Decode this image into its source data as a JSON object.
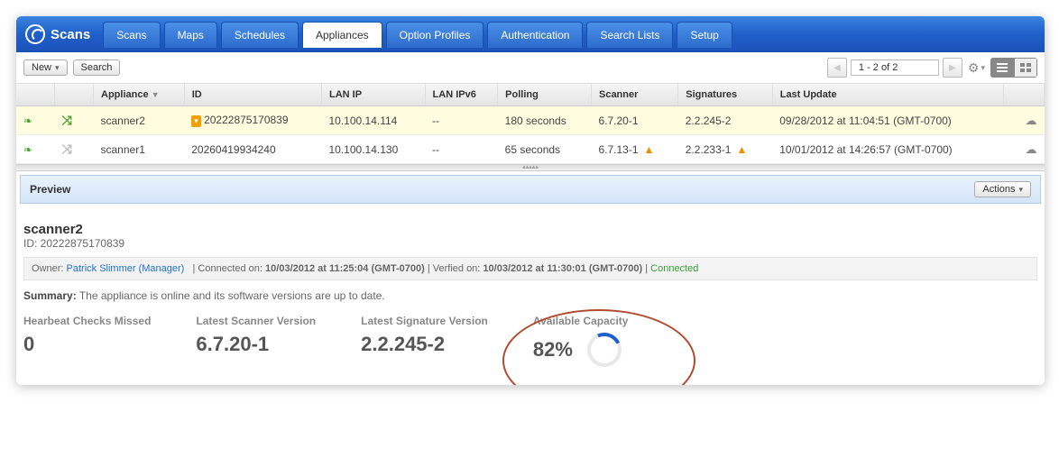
{
  "brand": "Scans",
  "tabs": [
    "Scans",
    "Maps",
    "Schedules",
    "Appliances",
    "Option Profiles",
    "Authentication",
    "Search Lists",
    "Setup"
  ],
  "activeTab": "Appliances",
  "toolbar": {
    "new": "New",
    "search": "Search",
    "pager": "1 - 2 of 2"
  },
  "columns": {
    "appliance": "Appliance",
    "id": "ID",
    "lanip": "LAN IP",
    "lanipv6": "LAN IPv6",
    "polling": "Polling",
    "scanner": "Scanner",
    "signatures": "Signatures",
    "lastupdate": "Last Update"
  },
  "rows": [
    {
      "selected": true,
      "linkActive": true,
      "appliance": "scanner2",
      "id": "20222875170839",
      "lanip": "10.100.14.114",
      "lanipv6": "--",
      "polling": "180 seconds",
      "scanner": "6.7.20-1",
      "scannerWarn": false,
      "signatures": "2.2.245-2",
      "sigWarn": false,
      "lastupdate": "09/28/2012 at 11:04:51 (GMT-0700)"
    },
    {
      "selected": false,
      "linkActive": false,
      "appliance": "scanner1",
      "id": "20260419934240",
      "lanip": "10.100.14.130",
      "lanipv6": "--",
      "polling": "65 seconds",
      "scanner": "6.7.13-1",
      "scannerWarn": true,
      "signatures": "2.2.233-1",
      "sigWarn": true,
      "lastupdate": "10/01/2012 at 14:26:57 (GMT-0700)"
    }
  ],
  "preview": {
    "header": "Preview",
    "actions": "Actions",
    "name": "scanner2",
    "idLabel": "ID: ",
    "id": "20222875170839",
    "ownerLabel": "Owner: ",
    "owner": "Patrick Slimmer (Manager)",
    "connectedLabel": "Connected on: ",
    "connectedOn": "10/03/2012 at 11:25:04 (GMT-0700)",
    "verifiedLabel": "Verfied on: ",
    "verifiedOn": "10/03/2012 at 11:30:01 (GMT-0700)",
    "status": "Connected",
    "summaryLabel": "Summary:",
    "summary": "The appliance is online and its software versions are up to date.",
    "stats": {
      "heartbeatLabel": "Hearbeat Checks Missed",
      "heartbeat": "0",
      "scannerLabel": "Latest Scanner Version",
      "scanner": "6.7.20-1",
      "sigLabel": "Latest Signature Version",
      "sig": "2.2.245-2",
      "capacityLabel": "Available Capacity",
      "capacity": "82%"
    }
  }
}
